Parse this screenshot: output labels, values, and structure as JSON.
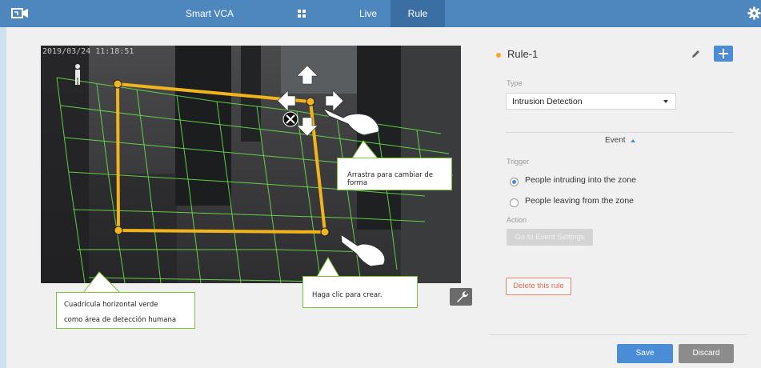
{
  "nav": {
    "vca_label": "Smart VCA",
    "live_label": "Live",
    "rule_label": "Rule"
  },
  "video": {
    "timestamp": "2019/03/24 11:18:51"
  },
  "callouts": {
    "drag_text": "Arrastra para cambiar de forma",
    "click_text": "Haga clic para crear.",
    "grid_line1": "Cuadrícula horizontal verde",
    "grid_line2": "como área de detección humana"
  },
  "rule": {
    "title": "Rule-1",
    "type_label": "Type",
    "type_value": "Intrusion Detection",
    "event_label": "Event",
    "trigger_label": "Trigger",
    "trigger_options": [
      {
        "label": "People intruding into the zone",
        "checked": true
      },
      {
        "label": "People leaving from the zone",
        "checked": false
      }
    ],
    "action_label": "Action",
    "event_settings_label": "Go to Event Settings",
    "delete_label": "Delete this rule",
    "save_label": "Save",
    "discard_label": "Discard"
  },
  "colors": {
    "topbar": "#4e86be",
    "accent": "#4a8cd6",
    "zone": "#f2b41c",
    "grid": "#66e04a",
    "callout_border": "#7dc242",
    "delete": "#e36a51",
    "rule_dot": "#f5a623"
  },
  "icons": {
    "logo": "camera-logo-icon",
    "grid": "grid-icon",
    "gear": "gear-icon",
    "pencil": "pencil-icon",
    "add": "plus-icon",
    "wrench": "wrench-icon",
    "close": "close-icon",
    "arrows": "move-arrows-icon",
    "hand": "pointing-hand-icon",
    "person": "person-size-icon"
  }
}
